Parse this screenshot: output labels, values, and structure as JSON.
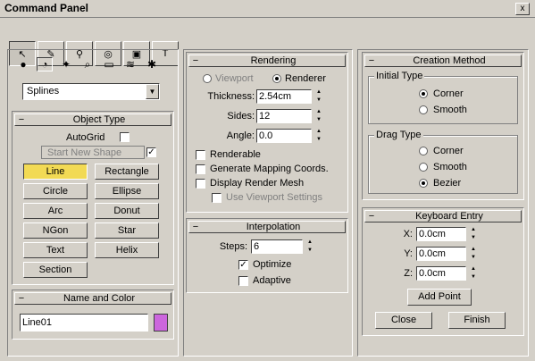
{
  "window": {
    "title": "Command Panel",
    "close_glyph": "x"
  },
  "main_tabs": [
    {
      "icon": "create-icon",
      "glyph": "↖"
    },
    {
      "icon": "modify-icon",
      "glyph": "✎"
    },
    {
      "icon": "hierarchy-icon",
      "glyph": "⚲"
    },
    {
      "icon": "motion-icon",
      "glyph": "◎"
    },
    {
      "icon": "display-icon",
      "glyph": "▣"
    },
    {
      "icon": "utilities-icon",
      "glyph": "T"
    }
  ],
  "create_categories": [
    {
      "icon": "geometry-icon",
      "glyph": "●"
    },
    {
      "icon": "shapes-icon",
      "glyph": "◔"
    },
    {
      "icon": "lights-icon",
      "glyph": "✦"
    },
    {
      "icon": "cameras-icon",
      "glyph": "⌕"
    },
    {
      "icon": "helpers-icon",
      "glyph": "▭"
    },
    {
      "icon": "spacewarps-icon",
      "glyph": "≋"
    },
    {
      "icon": "systems-icon",
      "glyph": "✱"
    }
  ],
  "category_dropdown": {
    "value": "Splines",
    "arrow": "▼"
  },
  "object_type": {
    "title": "Object Type",
    "minus": "−",
    "autogrid": "AutoGrid",
    "start_new_shape": "Start New Shape",
    "start_new_shape_checked": "✓",
    "buttons": [
      "Line",
      "Rectangle",
      "Circle",
      "Ellipse",
      "Arc",
      "Donut",
      "NGon",
      "Star",
      "Text",
      "Helix",
      "Section"
    ]
  },
  "name_and_color": {
    "title": "Name and Color",
    "minus": "−",
    "name_value": "Line01",
    "color": "#cc66dd"
  },
  "rendering": {
    "title": "Rendering",
    "minus": "−",
    "viewport": "Viewport",
    "renderer": "Renderer",
    "thickness_label": "Thickness:",
    "thickness_value": "2.54cm",
    "sides_label": "Sides:",
    "sides_value": "12",
    "angle_label": "Angle:",
    "angle_value": "0.0",
    "renderable": "Renderable",
    "generate_mapping": "Generate Mapping Coords.",
    "display_render_mesh": "Display Render Mesh",
    "use_viewport_settings": "Use Viewport Settings"
  },
  "interpolation": {
    "title": "Interpolation",
    "minus": "−",
    "steps_label": "Steps:",
    "steps_value": "6",
    "optimize": "Optimize",
    "optimize_checked": "✓",
    "adaptive": "Adaptive"
  },
  "creation_method": {
    "title": "Creation Method",
    "minus": "−",
    "initial_type": "Initial Type",
    "initial_options": [
      "Corner",
      "Smooth"
    ],
    "drag_type": "Drag Type",
    "drag_options": [
      "Corner",
      "Smooth",
      "Bezier"
    ]
  },
  "keyboard_entry": {
    "title": "Keyboard Entry",
    "minus": "−",
    "x_label": "X:",
    "x_value": "0.0cm",
    "y_label": "Y:",
    "y_value": "0.0cm",
    "z_label": "Z:",
    "z_value": "0.0cm",
    "add_point": "Add Point",
    "close": "Close",
    "finish": "Finish"
  },
  "spinner_glyphs": {
    "up": "▲",
    "down": "▼"
  }
}
